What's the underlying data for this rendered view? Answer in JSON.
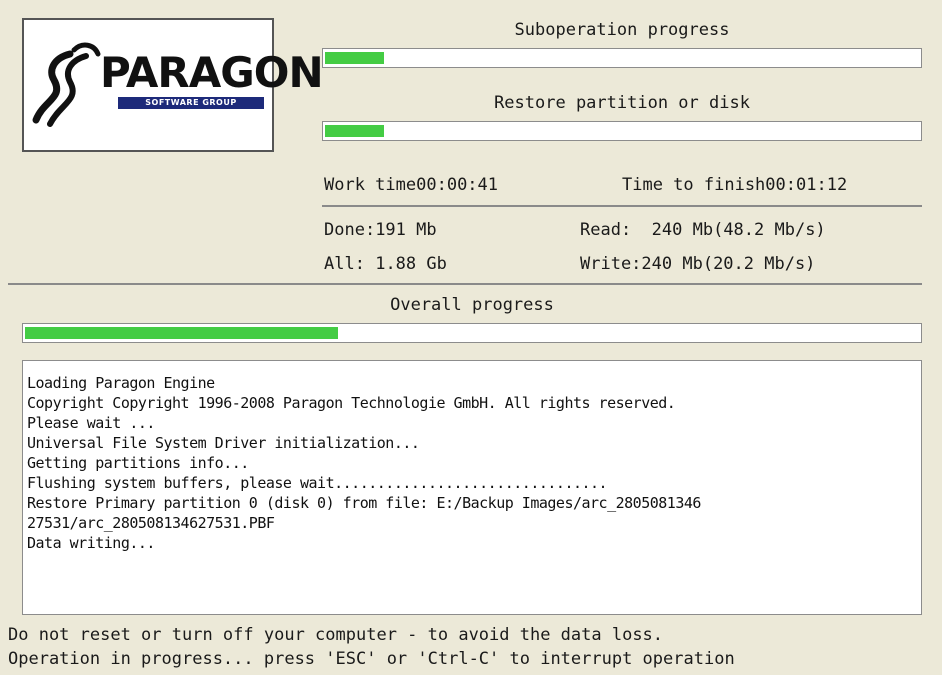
{
  "logo": {
    "wordmark": "PARAGON",
    "tagline": "SOFTWARE GROUP"
  },
  "suboperation": {
    "title": "Suboperation progress",
    "progress": 0.1
  },
  "operation": {
    "title": "Restore partition or disk",
    "progress": 0.1
  },
  "timing": {
    "work_time_label": "Work time",
    "work_time_value": "00:00:41",
    "time_to_finish_label": "Time to finish",
    "time_to_finish_value": "00:01:12"
  },
  "stats": {
    "done_label": "Done:",
    "done_value": "191 Mb",
    "all_label": "All:",
    "all_value": "1.88 Gb",
    "read_label": "Read:",
    "read_value": "240 Mb(48.2 Mb/s)",
    "write_label": "Write:",
    "write_value": "240 Mb(20.2 Mb/s)"
  },
  "overall": {
    "title": "Overall progress",
    "progress": 0.35
  },
  "log": {
    "lines": [
      "Loading Paragon Engine",
      "Copyright Copyright 1996-2008 Paragon Technologie GmbH. All rights reserved.",
      "Please wait ...",
      "Universal File System Driver initialization...",
      "Getting partitions info...",
      "Flushing system buffers, please wait................................",
      "Restore Primary partition 0 (disk 0) from file: E:/Backup Images/arc_2805081346",
      "27531/arc_280508134627531.PBF",
      "Data writing..."
    ]
  },
  "footer": {
    "line1": "Do not reset or turn off your computer - to avoid the data loss.",
    "line2": "Operation in progress... press 'ESC' or 'Ctrl-C' to interrupt operation"
  },
  "colors": {
    "progress_fill": "#44cc44",
    "background": "#ece9d8",
    "logo_band": "#1d2a7a"
  }
}
